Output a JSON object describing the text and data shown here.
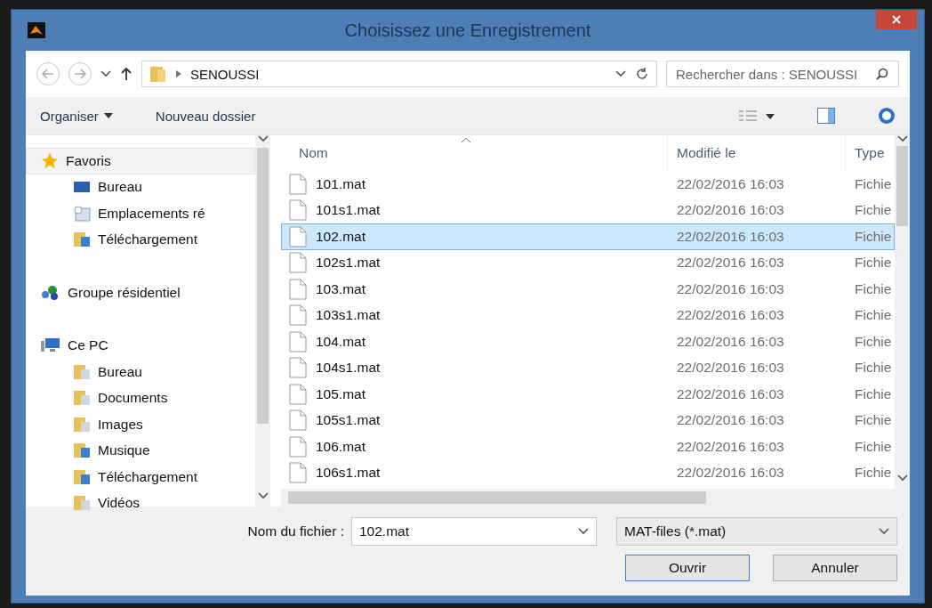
{
  "window": {
    "title": "Choisissez une Enregistrement"
  },
  "nav": {
    "path": "SENOUSSI",
    "search_placeholder": "Rechercher dans : SENOUSSI"
  },
  "commands": {
    "organize": "Organiser",
    "new_folder": "Nouveau dossier"
  },
  "sidebar": {
    "items": [
      {
        "label": "Favoris",
        "kind": "star",
        "selected": true,
        "children": [
          {
            "label": "Bureau",
            "kind": "desktop",
            "selected": false
          },
          {
            "label": "Emplacements ré",
            "kind": "recent",
            "selected": false
          },
          {
            "label": "Téléchargement",
            "kind": "download",
            "selected": false
          }
        ]
      },
      {
        "label": "Groupe résidentiel",
        "kind": "homegroup",
        "selected": false
      },
      {
        "label": "Ce PC",
        "kind": "pc",
        "selected": false,
        "children": [
          {
            "label": "Bureau",
            "kind": "desktopfolder",
            "selected": false
          },
          {
            "label": "Documents",
            "kind": "docs",
            "selected": false
          },
          {
            "label": "Images",
            "kind": "images",
            "selected": false
          },
          {
            "label": "Musique",
            "kind": "music",
            "selected": false
          },
          {
            "label": "Téléchargement",
            "kind": "download",
            "selected": false
          },
          {
            "label": "Vidéos",
            "kind": "video",
            "selected": false
          }
        ]
      }
    ]
  },
  "table": {
    "columns": [
      "Nom",
      "Modifié le",
      "Type"
    ],
    "rows": [
      {
        "name": "101.mat",
        "modified": "22/02/2016 16:03",
        "type": "Fichie",
        "selected": false
      },
      {
        "name": "101s1.mat",
        "modified": "22/02/2016 16:03",
        "type": "Fichie",
        "selected": false
      },
      {
        "name": "102.mat",
        "modified": "22/02/2016 16:03",
        "type": "Fichie",
        "selected": true
      },
      {
        "name": "102s1.mat",
        "modified": "22/02/2016 16:03",
        "type": "Fichie",
        "selected": false
      },
      {
        "name": "103.mat",
        "modified": "22/02/2016 16:03",
        "type": "Fichie",
        "selected": false
      },
      {
        "name": "103s1.mat",
        "modified": "22/02/2016 16:03",
        "type": "Fichie",
        "selected": false
      },
      {
        "name": "104.mat",
        "modified": "22/02/2016 16:03",
        "type": "Fichie",
        "selected": false
      },
      {
        "name": "104s1.mat",
        "modified": "22/02/2016 16:03",
        "type": "Fichie",
        "selected": false
      },
      {
        "name": "105.mat",
        "modified": "22/02/2016 16:03",
        "type": "Fichie",
        "selected": false
      },
      {
        "name": "105s1.mat",
        "modified": "22/02/2016 16:03",
        "type": "Fichie",
        "selected": false
      },
      {
        "name": "106.mat",
        "modified": "22/02/2016 16:03",
        "type": "Fichie",
        "selected": false
      },
      {
        "name": "106s1.mat",
        "modified": "22/02/2016 16:03",
        "type": "Fichie",
        "selected": false
      }
    ]
  },
  "footer": {
    "filename_label": "Nom du fichier :",
    "filename": "102.mat",
    "filter": "MAT-files (*.mat)",
    "buttons": [
      "Ouvrir",
      "Annuler"
    ]
  }
}
